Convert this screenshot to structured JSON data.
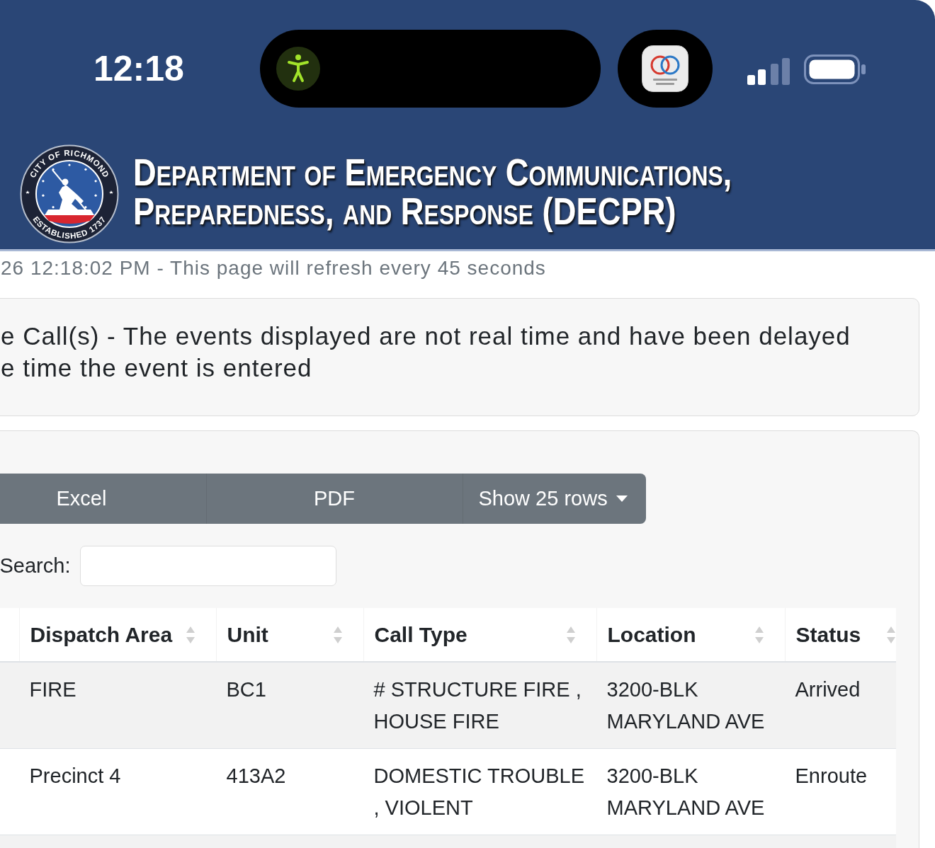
{
  "status_bar": {
    "time": "12:18"
  },
  "header": {
    "seal": {
      "top_text": "CITY OF RICHMOND",
      "bottom_text": "ESTABLISHED 1737"
    },
    "title_lines": [
      "Department of Emergency Communications,",
      "Preparedness, and Response (DECPR)"
    ]
  },
  "refresh_notice": "26 12:18:02 PM - This page will refresh every 45 seconds",
  "alert": {
    "lines": [
      "e Call(s) - The events displayed are not real time and have been delayed",
      "e time the event is entered"
    ]
  },
  "toolbar": {
    "buttons": [
      {
        "label": "Excel",
        "kind": "button"
      },
      {
        "label": "PDF",
        "kind": "button"
      },
      {
        "label": "Show 25 rows",
        "kind": "dropdown"
      }
    ]
  },
  "search": {
    "label": "Search:"
  },
  "table": {
    "columns": [
      "Dispatch Area",
      "Unit",
      "Call Type",
      "Location",
      "Status"
    ],
    "rows": [
      {
        "cells": [
          "FIRE",
          "BC1",
          "# STRUCTURE FIRE , HOUSE FIRE",
          "3200-BLK MARYLAND AVE",
          "Arrived"
        ]
      },
      {
        "cells": [
          "Precinct 4",
          "413A2",
          "DOMESTIC TROUBLE , VIOLENT",
          "3200-BLK MARYLAND AVE",
          "Enroute"
        ]
      }
    ]
  }
}
